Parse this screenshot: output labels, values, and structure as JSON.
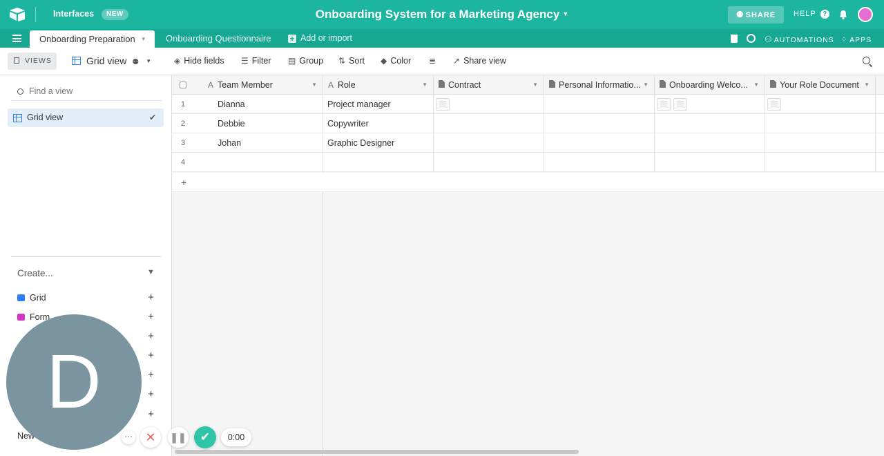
{
  "topbar": {
    "interfaces_label": "Interfaces",
    "new_badge": "NEW",
    "base_title": "Onboarding System for a Marketing Agency",
    "share_label": "SHARE",
    "help_label": "HELP",
    "accent_color": "#1cb5a0"
  },
  "tabs": {
    "items": [
      {
        "label": "Onboarding Preparation",
        "active": true
      },
      {
        "label": "Onboarding Questionnaire",
        "active": false
      }
    ],
    "add_label": "Add or import",
    "automations_label": "AUTOMATIONS",
    "apps_label": "APPS"
  },
  "toolbar": {
    "views_label": "VIEWS",
    "view_name": "Grid view",
    "hide_fields": "Hide fields",
    "filter": "Filter",
    "group": "Group",
    "sort": "Sort",
    "color": "Color",
    "share_view": "Share view"
  },
  "sidebar": {
    "search_placeholder": "Find a view",
    "views": [
      {
        "label": "Grid view",
        "selected": true
      }
    ],
    "create_label": "Create...",
    "create_items": [
      {
        "label": "Grid",
        "icon": "grid-icon",
        "color": "#2d7ff9"
      },
      {
        "label": "Form",
        "icon": "form-icon",
        "color": "#d037c4"
      }
    ],
    "new_label": "New"
  },
  "grid": {
    "columns": [
      {
        "label": "Team Member",
        "type": "text"
      },
      {
        "label": "Role",
        "type": "text"
      },
      {
        "label": "Contract",
        "type": "attachment"
      },
      {
        "label": "Personal Informatio...",
        "type": "attachment"
      },
      {
        "label": "Onboarding Welco...",
        "type": "attachment"
      },
      {
        "label": "Your Role Document",
        "type": "attachment"
      }
    ],
    "rows": [
      {
        "num": "1",
        "team_member": "Dianna",
        "role": "Project manager"
      },
      {
        "num": "2",
        "team_member": "Debbie",
        "role": "Copywriter"
      },
      {
        "num": "3",
        "team_member": "Johan",
        "role": "Graphic Designer"
      },
      {
        "num": "4",
        "team_member": "",
        "role": ""
      }
    ],
    "add_row": "+"
  },
  "recorder": {
    "avatar_letter": "D",
    "timer": "0:00"
  }
}
